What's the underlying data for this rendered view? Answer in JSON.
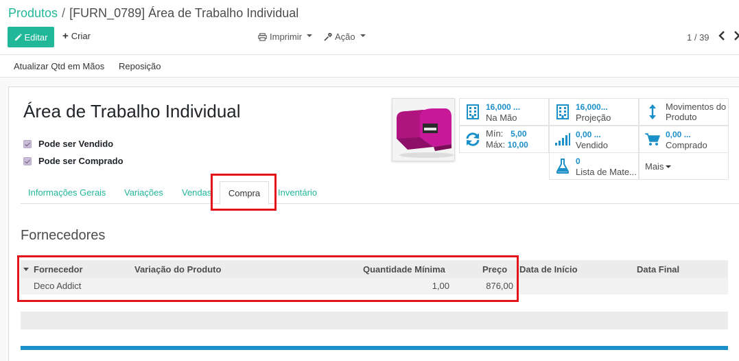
{
  "breadcrumb": {
    "parent": "Produtos",
    "separator": "/",
    "current": "[FURN_0789] Área de Trabalho Individual"
  },
  "toolbar": {
    "edit_label": "Editar",
    "create_label": "Criar",
    "print_label": "Imprimir",
    "action_label": "Ação"
  },
  "pager": {
    "value": "1 / 39"
  },
  "statusbar": {
    "update_qty_label": "Atualizar Qtd em Mãos",
    "replenish_label": "Reposição"
  },
  "product": {
    "name": "Área de Trabalho Individual",
    "can_be_sold_label": "Pode ser Vendido",
    "can_be_purchased_label": "Pode ser Comprado"
  },
  "stats": {
    "on_hand": {
      "value": "16,000 ...",
      "label": "Na Mão"
    },
    "forecast": {
      "value": "16,000...",
      "label": "Projeção"
    },
    "moves": {
      "label1": "Movimentos do",
      "label2": "Produto"
    },
    "minmax": {
      "min_label": "Mín:",
      "min_value": "5,00",
      "max_label": "Máx:",
      "max_value": "10,00"
    },
    "sold": {
      "value": "0,00 ...",
      "label": "Vendido"
    },
    "purchased": {
      "value": "0,00 ...",
      "label": "Comprado"
    },
    "bom": {
      "value": "0",
      "label": "Lista de Mate..."
    },
    "more": {
      "label": "Mais"
    }
  },
  "tabs": [
    {
      "label": "Informações Gerais"
    },
    {
      "label": "Variações"
    },
    {
      "label": "Vendas"
    },
    {
      "label": "Compra"
    },
    {
      "label": "Inventário"
    }
  ],
  "suppliers": {
    "title": "Fornecedores",
    "columns": [
      "Fornecedor",
      "Variação do Produto",
      "Quantidade Mínima",
      "Preço",
      "Data de Início",
      "Data Final"
    ],
    "rows": [
      {
        "vendor": "Deco Addict",
        "variant": "",
        "min_qty": "1,00",
        "price": "876,00",
        "date_start": "",
        "date_end": ""
      }
    ]
  },
  "colors": {
    "accent": "#21b799",
    "stat_value": "#1b8fc8",
    "highlight": "#e5141b"
  }
}
